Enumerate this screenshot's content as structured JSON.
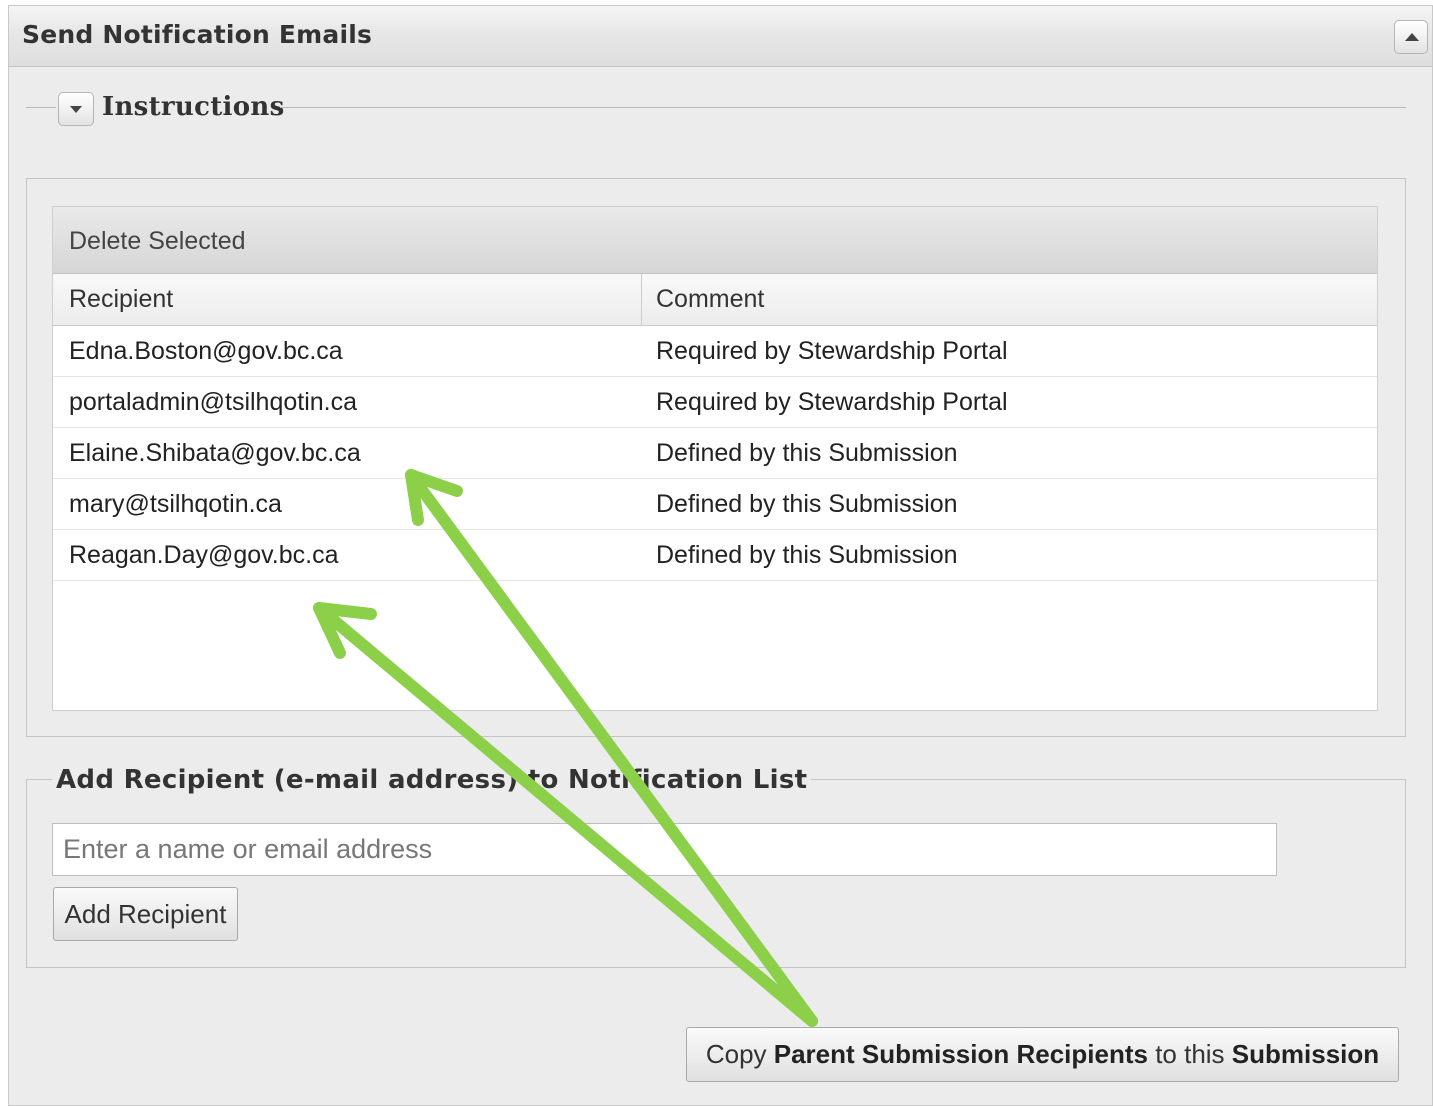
{
  "panel": {
    "title": "Send Notification Emails"
  },
  "instructions": {
    "label": "Instructions"
  },
  "grid": {
    "toolbar_button": "Delete Selected",
    "columns": [
      "Recipient",
      "Comment"
    ],
    "rows": [
      {
        "recipient": "Edna.Boston@gov.bc.ca",
        "comment": "Required by Stewardship Portal"
      },
      {
        "recipient": "portaladmin@tsilhqotin.ca",
        "comment": "Required by Stewardship Portal"
      },
      {
        "recipient": "Elaine.Shibata@gov.bc.ca",
        "comment": "Defined by this Submission"
      },
      {
        "recipient": "mary@tsilhqotin.ca",
        "comment": "Defined by this Submission"
      },
      {
        "recipient": "Reagan.Day@gov.bc.ca",
        "comment": "Defined by this Submission"
      }
    ]
  },
  "add_recipient": {
    "legend": "Add Recipient (e-mail address) to Notification List",
    "input_placeholder": "Enter a name or email address",
    "input_value": "",
    "button_label": "Add Recipient"
  },
  "copy_button": {
    "part1": "Copy ",
    "part2": "Parent Submission Recipients",
    "part3": " to this ",
    "part4": "Submission"
  },
  "annotation": {
    "arrow_color": "#8cd04a"
  }
}
